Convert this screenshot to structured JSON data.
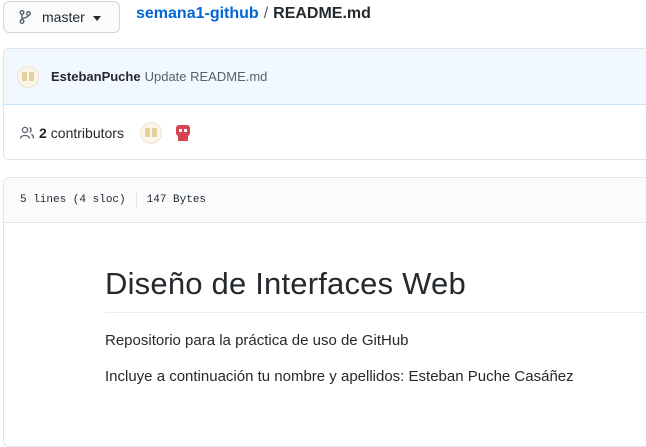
{
  "branch": {
    "label": "master",
    "icon": "git-branch-icon"
  },
  "breadcrumb": {
    "repo": "semana1-github",
    "separator": "/",
    "file": "README.md"
  },
  "commit": {
    "author": "EstebanPuche",
    "message": "Update README.md"
  },
  "contributors": {
    "count": "2",
    "label": "contributors",
    "icon": "people-icon"
  },
  "file_info": {
    "lines": "5 lines (4 sloc)",
    "size": "147 Bytes"
  },
  "readme": {
    "heading": "Diseño de Interfaces Web",
    "paragraph1": "Repositorio para la práctica de uso de GitHub",
    "paragraph2": "Incluye a continuación tu nombre y apellidos: Esteban Puche Casáñez"
  },
  "colors": {
    "link": "#0366d6",
    "commit_bg": "#f1f8ff",
    "avatar_red": "#d9434f"
  }
}
